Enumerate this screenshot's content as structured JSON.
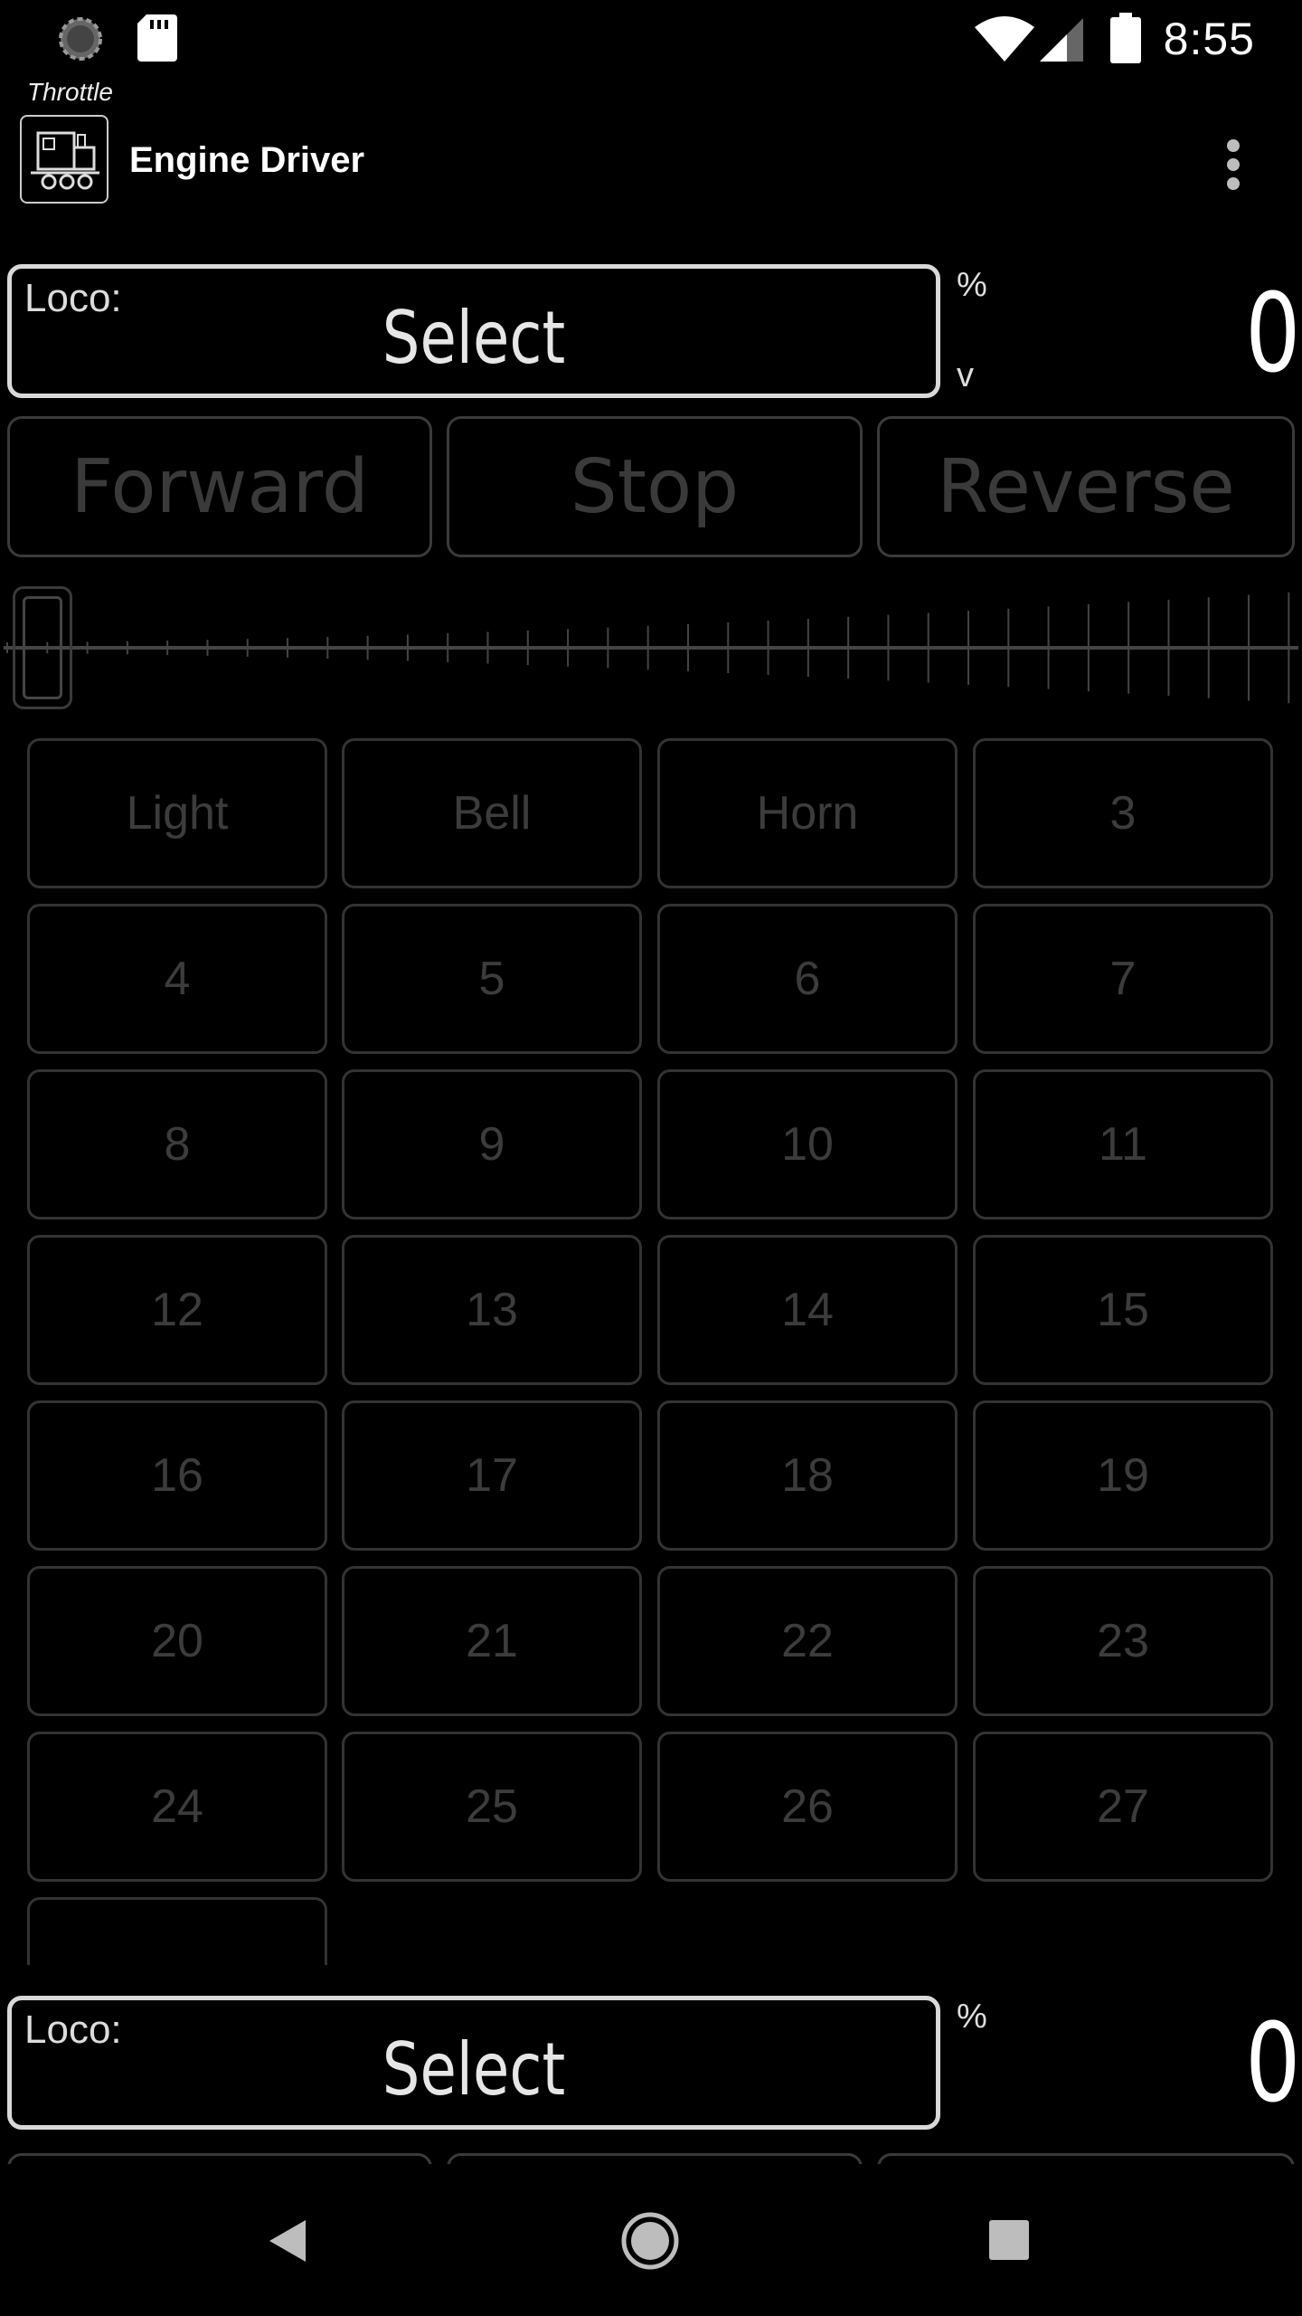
{
  "status_bar": {
    "time": "8:55",
    "icons": [
      "sync-icon",
      "sd-card-icon",
      "wifi-icon",
      "cell-signal-icon",
      "battery-icon"
    ]
  },
  "app_bar": {
    "mode": "Throttle",
    "title": "Engine Driver",
    "logo_icon": "train-logo-icon",
    "menu_icon": "overflow-menu-icon"
  },
  "throttle1": {
    "loco_label": "Loco:",
    "select_label": "Select",
    "speed_unit_top": "%",
    "speed_unit_bottom": "v",
    "speed": "0",
    "slider_value_percent": 0,
    "directions": [
      "Forward",
      "Stop",
      "Reverse"
    ],
    "functions": [
      "Light",
      "Bell",
      "Horn",
      "3",
      "4",
      "5",
      "6",
      "7",
      "8",
      "9",
      "10",
      "11",
      "12",
      "13",
      "14",
      "15",
      "16",
      "17",
      "18",
      "19",
      "20",
      "21",
      "22",
      "23",
      "24",
      "25",
      "26",
      "27"
    ]
  },
  "throttle2": {
    "loco_label": "Loco:",
    "select_label": "Select",
    "speed_unit_top": "%",
    "speed": "0"
  },
  "nav_bar": {
    "buttons": [
      "back-icon",
      "home-icon",
      "recents-icon"
    ]
  },
  "colors": {
    "background": "#000000",
    "disabled_text": "#3a3a3a",
    "loco_border": "#d9d9d9"
  }
}
